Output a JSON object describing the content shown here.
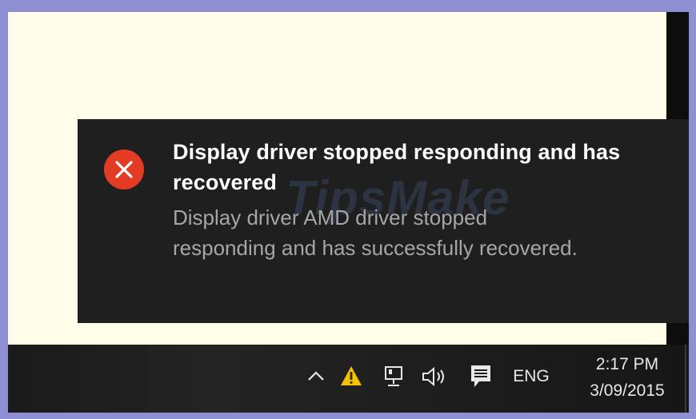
{
  "notification": {
    "icon": "error-x-icon",
    "title": "Display driver stopped responding and has recovered",
    "body": "Display driver AMD driver stopped responding and has successfully recovered.",
    "watermark": "TipsMake"
  },
  "taskbar": {
    "tray": {
      "show_hidden_icon": "chevron-up-icon",
      "warning_icon": "warning-icon",
      "network_icon": "network-icon",
      "volume_icon": "volume-icon",
      "action_center_icon": "action-center-icon",
      "language": "ENG"
    },
    "clock": {
      "time": "2:17 PM",
      "date": "3/09/2015"
    }
  },
  "colors": {
    "error_red": "#e23c25",
    "warning_yellow": "#f5c200",
    "toast_bg": "#1f1f1f"
  }
}
